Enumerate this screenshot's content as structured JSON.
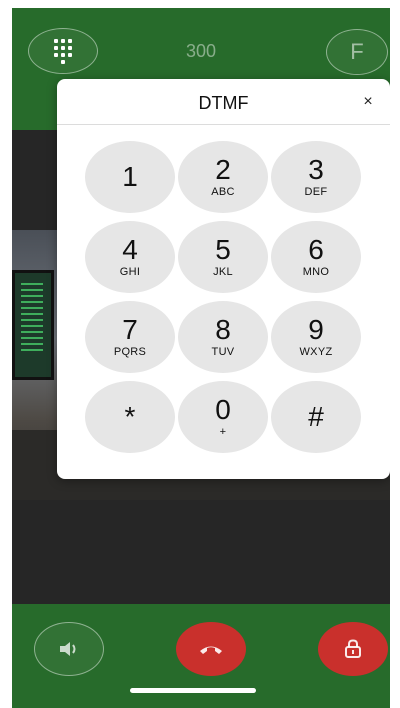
{
  "header": {
    "call_number": "300",
    "avatar_initial": "F",
    "dialpad_icon": "dialpad-grid-icon"
  },
  "dtmf": {
    "title": "DTMF",
    "close_label": "×",
    "keys": [
      {
        "digit": "1",
        "letters": ""
      },
      {
        "digit": "2",
        "letters": "ABC"
      },
      {
        "digit": "3",
        "letters": "DEF"
      },
      {
        "digit": "4",
        "letters": "GHI"
      },
      {
        "digit": "5",
        "letters": "JKL"
      },
      {
        "digit": "6",
        "letters": "MNO"
      },
      {
        "digit": "7",
        "letters": "PQRS"
      },
      {
        "digit": "8",
        "letters": "TUV"
      },
      {
        "digit": "9",
        "letters": "WXYZ"
      },
      {
        "digit": "*",
        "letters": ""
      },
      {
        "digit": "0",
        "letters": "+"
      },
      {
        "digit": "#",
        "letters": ""
      }
    ]
  },
  "controls": {
    "speaker_icon": "speaker-icon",
    "hangup_icon": "hang-up-icon",
    "lock_icon": "lock-icon"
  },
  "colors": {
    "bar_green": "#276b2b",
    "hangup_red": "#c9302c",
    "key_gray": "#e6e6e6"
  }
}
